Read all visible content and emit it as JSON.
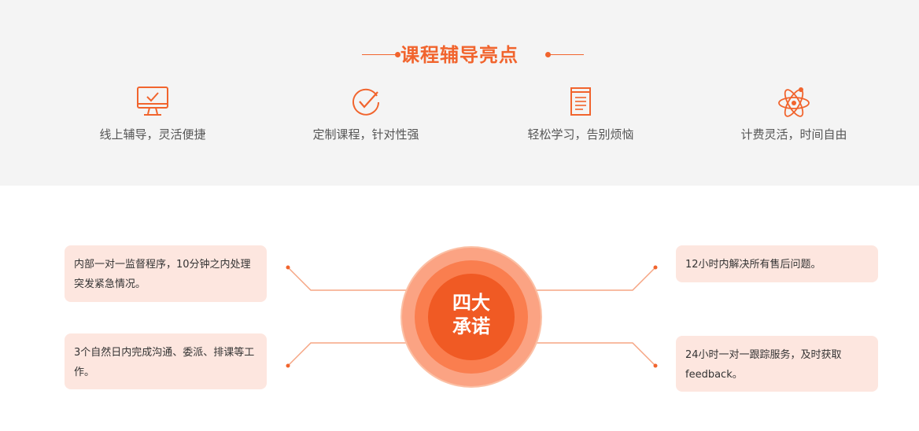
{
  "header": {
    "title": "课程辅导亮点",
    "accent_color": "#f1642d"
  },
  "features": [
    {
      "icon": "monitor-check-icon",
      "label": "线上辅导，灵活便捷"
    },
    {
      "icon": "circle-check-icon",
      "label": "定制课程，针对性强"
    },
    {
      "icon": "document-icon",
      "label": "轻松学习，告别烦恼"
    },
    {
      "icon": "atom-icon",
      "label": "计费灵活，时间自由"
    }
  ],
  "promises": {
    "center_line1": "四大",
    "center_line2": "承诺",
    "top_left": "内部一对一监督程序，10分钟之内处理突发紧急情况。",
    "bottom_left": "3个自然日内完成沟通、委派、排课等工作。",
    "top_right": "12小时内解决所有售后问题。",
    "bottom_right": "24小时一对一跟踪服务，及时获取feedback。",
    "card_color": "#fde6df"
  }
}
